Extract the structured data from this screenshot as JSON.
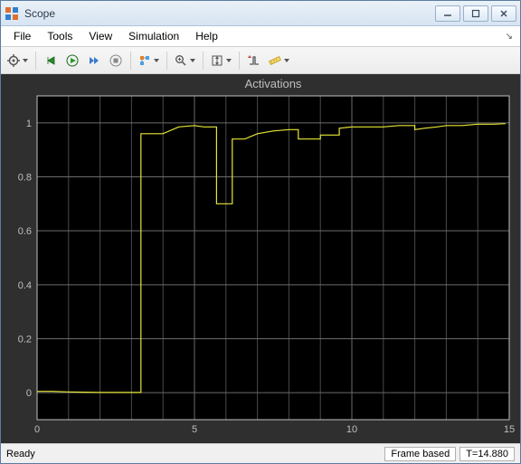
{
  "window": {
    "title": "Scope"
  },
  "menu": {
    "items": [
      "File",
      "Tools",
      "View",
      "Simulation",
      "Help"
    ]
  },
  "toolbar": {
    "icons": [
      "config",
      "restart",
      "run",
      "step",
      "stop",
      "highlight",
      "zoom",
      "autoscale",
      "trigger",
      "measure"
    ]
  },
  "chart_data": {
    "type": "line",
    "title": "Activations",
    "xlabel": "",
    "ylabel": "",
    "xlim": [
      0,
      15
    ],
    "ylim": [
      -0.1,
      1.1
    ],
    "xticks": [
      0,
      5,
      10,
      15
    ],
    "yticks": [
      0,
      0.2,
      0.4,
      0.6,
      0.8,
      1
    ],
    "xminor": [
      1,
      2,
      3,
      4,
      6,
      7,
      8,
      9,
      11,
      12,
      13,
      14
    ],
    "series": [
      {
        "name": "activation",
        "color": "#e6e636",
        "x": [
          0.0,
          0.5,
          1.0,
          1.5,
          2.0,
          2.5,
          3.0,
          3.3,
          3.3,
          3.6,
          4.0,
          4.5,
          5.0,
          5.3,
          5.7,
          5.7,
          6.2,
          6.2,
          6.6,
          7.0,
          7.5,
          8.0,
          8.3,
          8.3,
          8.7,
          9.0,
          9.0,
          9.4,
          9.6,
          9.6,
          10.0,
          10.5,
          11.0,
          11.5,
          12.0,
          12.0,
          12.3,
          12.7,
          13.0,
          13.5,
          14.0,
          14.5,
          14.88
        ],
        "y": [
          0.005,
          0.005,
          0.003,
          0.002,
          0.001,
          0.001,
          0.001,
          0.001,
          0.96,
          0.96,
          0.96,
          0.985,
          0.99,
          0.985,
          0.985,
          0.7,
          0.7,
          0.94,
          0.94,
          0.96,
          0.97,
          0.975,
          0.975,
          0.94,
          0.94,
          0.94,
          0.955,
          0.955,
          0.955,
          0.98,
          0.985,
          0.985,
          0.985,
          0.99,
          0.99,
          0.975,
          0.98,
          0.985,
          0.99,
          0.99,
          0.995,
          0.995,
          0.997
        ]
      }
    ]
  },
  "status": {
    "text": "Ready",
    "mode": "Frame based",
    "time": "T=14.880"
  }
}
